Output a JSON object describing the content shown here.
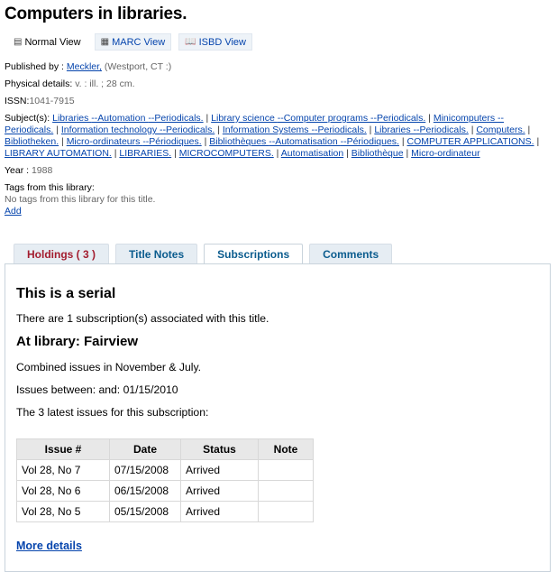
{
  "record": {
    "title": "Computers in libraries."
  },
  "view_tabs": [
    {
      "label": "Normal View",
      "icon": "document-icon",
      "active": true
    },
    {
      "label": "MARC View",
      "icon": "marc-icon",
      "active": false
    },
    {
      "label": "ISBD View",
      "icon": "book-icon",
      "active": false
    }
  ],
  "details": {
    "published_label": "Published by : ",
    "publisher": "Meckler,",
    "publisher_place": "(Westport, CT :)",
    "physical_label": "Physical details: ",
    "physical_value": "v. : ill. ; 28 cm.",
    "issn_label": "ISSN:",
    "issn_value": "1041-7915",
    "subjects_label": "Subject(s): ",
    "year_label": "Year : ",
    "year_value": "1988",
    "tags_label": "Tags from this library:",
    "tags_value": "No tags from this library for this title.",
    "add_label": "Add"
  },
  "subjects": [
    [
      "Libraries ",
      "--Automation ",
      "--Periodicals."
    ],
    [
      "Library science ",
      "--Computer programs ",
      "--Periodicals."
    ],
    [
      "Minicomputers ",
      "--Periodicals."
    ],
    [
      "Information technology ",
      "--Periodicals."
    ],
    [
      "Information Systems ",
      "--Periodicals."
    ],
    [
      "Libraries ",
      "--Periodicals."
    ],
    [
      "Computers."
    ],
    [
      "Bibliotheken."
    ],
    [
      "Micro-ordinateurs ",
      "--Périodiques."
    ],
    [
      "Bibliothèques ",
      "--Automatisation ",
      "--Périodiques."
    ],
    [
      "COMPUTER APPLICATIONS."
    ],
    [
      "LIBRARY AUTOMATION."
    ],
    [
      "LIBRARIES."
    ],
    [
      "MICROCOMPUTERS."
    ],
    [
      "Automatisation"
    ],
    [
      "Bibliothèque"
    ],
    [
      "Micro-ordinateur"
    ]
  ],
  "record_tabs": [
    {
      "label": "Holdings ( 3 )",
      "active": false
    },
    {
      "label": "Title Notes",
      "active": false
    },
    {
      "label": "Subscriptions",
      "active": true
    },
    {
      "label": "Comments",
      "active": false
    }
  ],
  "subscriptions": {
    "heading": "This is a serial",
    "count_text": "There are 1 subscription(s) associated with this title.",
    "library_heading": "At library: Fairview",
    "note": "Combined issues in November & July.",
    "between": "Issues between: and: 01/15/2010",
    "latest_text": "The 3 latest issues for this subscription:",
    "columns": [
      "Issue #",
      "Date",
      "Status",
      "Note"
    ],
    "rows": [
      [
        "Vol 28, No 7",
        "07/15/2008",
        "Arrived",
        ""
      ],
      [
        "Vol 28, No 6",
        "06/15/2008",
        "Arrived",
        ""
      ],
      [
        "Vol 28, No 5",
        "05/15/2008",
        "Arrived",
        ""
      ]
    ],
    "more_details": "More details"
  },
  "colors": {
    "link": "#0645AD",
    "tab_text": "#0B5C8E",
    "holdings_tab_text": "#A31D2F",
    "table_header_bg": "#E8E8E8"
  }
}
